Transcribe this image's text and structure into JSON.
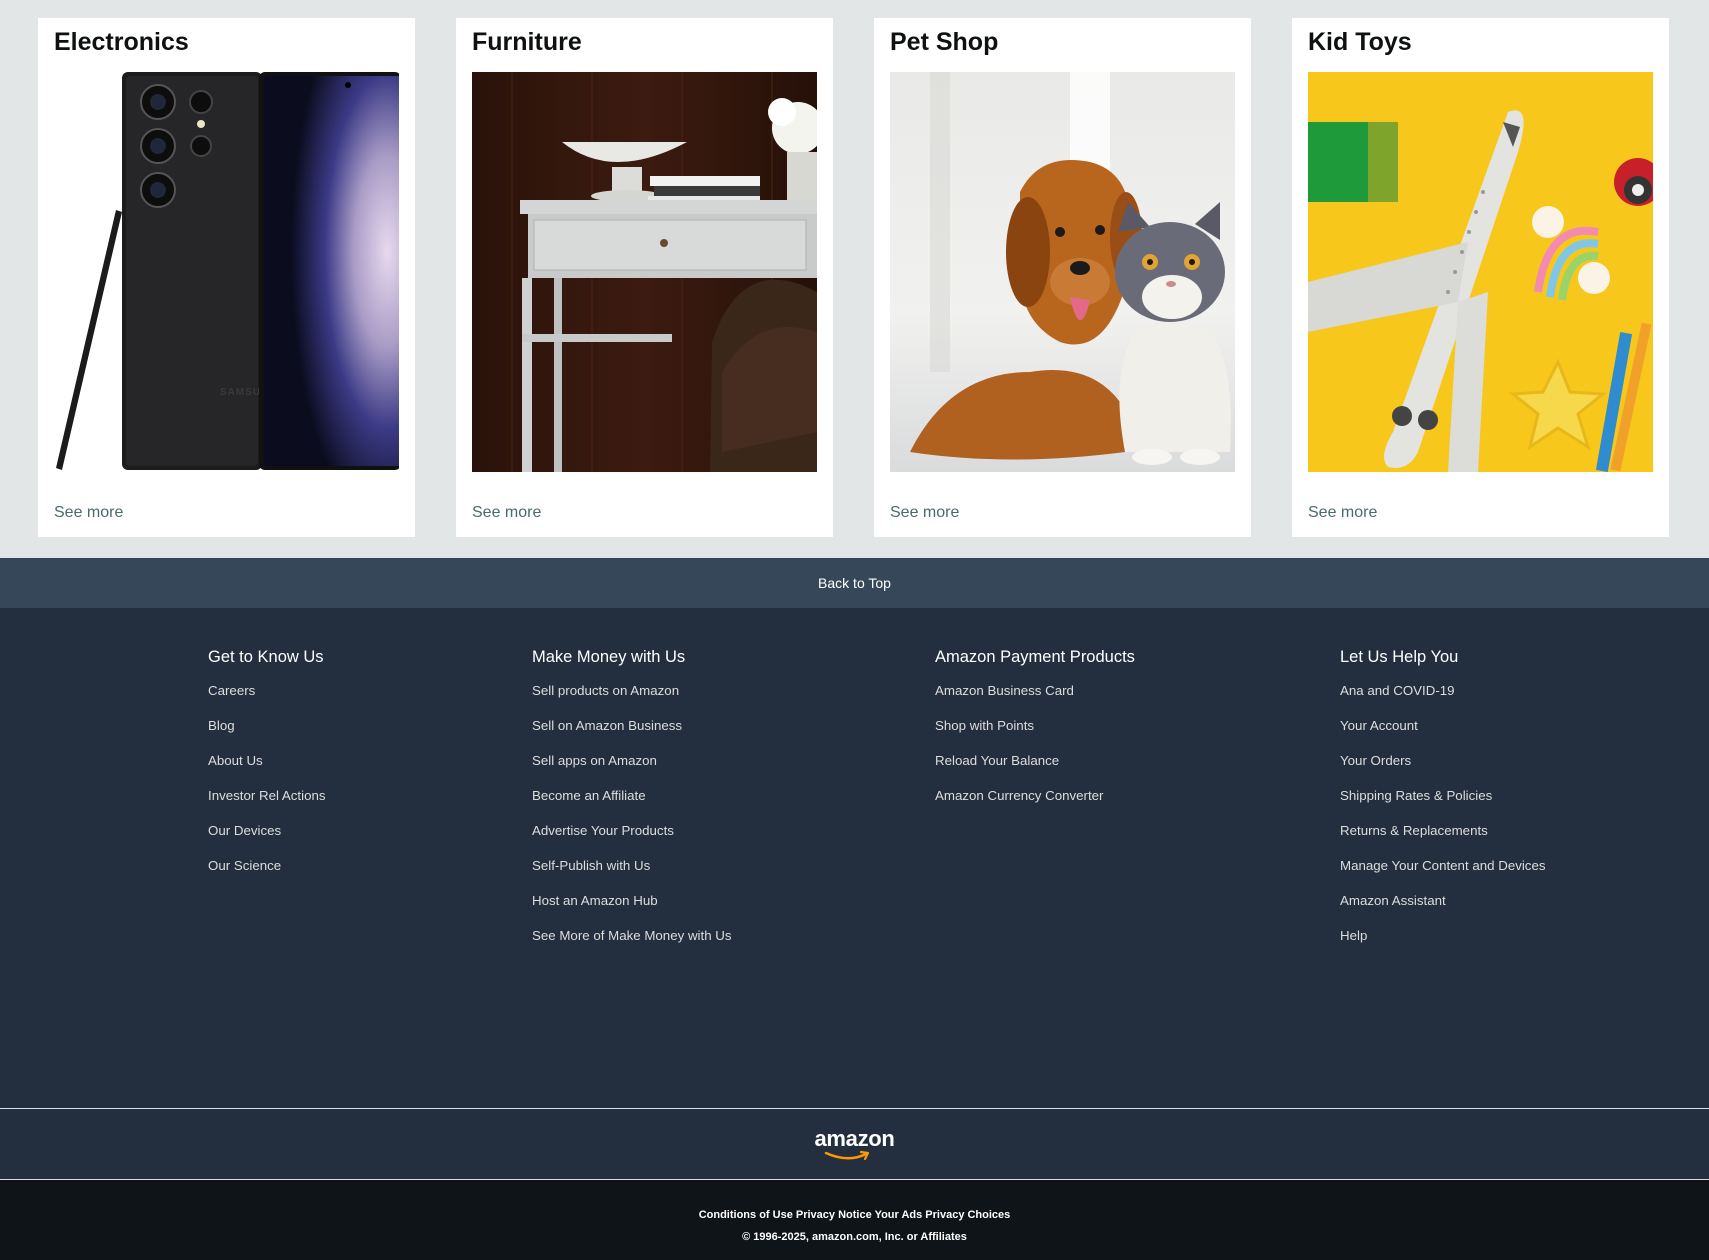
{
  "cards": [
    {
      "title": "Electronics",
      "see_more": "See more",
      "image": "phone-with-stylus-image",
      "brand_text": "SAMSUNG"
    },
    {
      "title": "Furniture",
      "see_more": "See more",
      "image": "desk-image"
    },
    {
      "title": "Pet Shop",
      "see_more": "See more",
      "image": "dog-and-cat-image"
    },
    {
      "title": "Kid Toys",
      "see_more": "See more",
      "image": "toy-airplane-image"
    }
  ],
  "back_to_top": "Back to Top",
  "footer": {
    "columns": [
      {
        "heading": "Get to Know Us",
        "links": [
          "Careers",
          "Blog",
          "About Us",
          "Investor Rel Actions",
          "Our Devices",
          "Our Science"
        ]
      },
      {
        "heading": "Make Money with Us",
        "links": [
          "Sell products on Amazon",
          "Sell on Amazon Business",
          "Sell apps on Amazon",
          "Become an Affiliate",
          "Advertise Your Products",
          "Self-Publish with Us",
          "Host an Amazon Hub",
          "See More of Make Money with Us"
        ]
      },
      {
        "heading": "Amazon Payment Products",
        "links": [
          "Amazon Business Card",
          "Shop with Points",
          "Reload Your Balance",
          "Amazon Currency Converter"
        ]
      },
      {
        "heading": "Let Us Help You",
        "links": [
          "Ana and COVID-19",
          "Your Account",
          "Your Orders",
          "Shipping Rates & Policies",
          "Returns & Replacements",
          "Manage Your Content and Devices",
          "Amazon Assistant",
          "Help"
        ]
      }
    ],
    "logo_text": "amazon",
    "legal_links": [
      "Conditions of Use",
      "Privacy Notice",
      "Your Ads Privacy Choices"
    ],
    "copyright": "© 1996-2025, amazon.com, Inc. or Affiliates"
  },
  "colors": {
    "page_bg": "#e3e6e6",
    "back_to_top_bg": "#37475a",
    "footer_bg": "#232f3e",
    "legal_bg": "#0f1418",
    "logo_smile": "#ff9900"
  }
}
